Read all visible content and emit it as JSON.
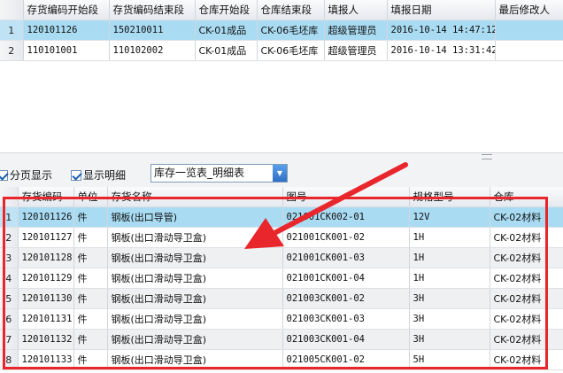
{
  "top_grid": {
    "columns": [
      "存货编码开始段",
      "存货编码结束段",
      "仓库开始段",
      "仓库结束段",
      "填报人",
      "填报日期",
      "最后修改人"
    ],
    "rows": [
      {
        "no": "1",
        "cells": [
          "120101126",
          "150210011",
          "CK-01成品",
          "CK-06毛坯库",
          "超级管理员",
          "2016-10-14 14:47:12",
          ""
        ]
      },
      {
        "no": "2",
        "cells": [
          "110101001",
          "110102002",
          "CK-01成品",
          "CK-06毛坯库",
          "超级管理员",
          "2016-10-14 13:31:42",
          ""
        ]
      }
    ]
  },
  "toolbar": {
    "paging_label": "分页显示",
    "detail_label": "显示明细",
    "paging_checked": true,
    "detail_checked": true,
    "report_select_value": "库存一览表_明细表"
  },
  "bottom_grid": {
    "columns": [
      "存货编码",
      "单位",
      "存货名称",
      "图号",
      "规格型号",
      "仓库"
    ],
    "rows": [
      {
        "no": "1",
        "cells": [
          "120101126",
          "件",
          "钢板(出口导管)",
          "021001CK002-01",
          "12V",
          "CK-02材料"
        ]
      },
      {
        "no": "2",
        "cells": [
          "120101127",
          "件",
          "钢板(出口滑动导卫盒)",
          "021001CK001-02",
          "1H",
          "CK-02材料"
        ]
      },
      {
        "no": "3",
        "cells": [
          "120101128",
          "件",
          "钢板(出口滑动导卫盒)",
          "021001CK001-03",
          "1H",
          "CK-02材料"
        ]
      },
      {
        "no": "4",
        "cells": [
          "120101129",
          "件",
          "钢板(出口滑动导卫盒)",
          "021001CK001-04",
          "1H",
          "CK-02材料"
        ]
      },
      {
        "no": "5",
        "cells": [
          "120101130",
          "件",
          "钢板(出口滑动导卫盒)",
          "021003CK001-02",
          "3H",
          "CK-02材料"
        ]
      },
      {
        "no": "6",
        "cells": [
          "120101131",
          "件",
          "钢板(出口滑动导卫盒)",
          "021003CK001-03",
          "3H",
          "CK-02材料"
        ]
      },
      {
        "no": "7",
        "cells": [
          "120101132",
          "件",
          "钢板(出口滑动导卫盒)",
          "021003CK001-04",
          "3H",
          "CK-02材料"
        ]
      },
      {
        "no": "8",
        "cells": [
          "120101133",
          "件",
          "钢板(出口滑动导卫盒)",
          "021005CK001-02",
          "5H",
          "CK-02材料"
        ]
      }
    ]
  },
  "annotation_color": "#e8262c",
  "selection_color": "#a9dcf3"
}
